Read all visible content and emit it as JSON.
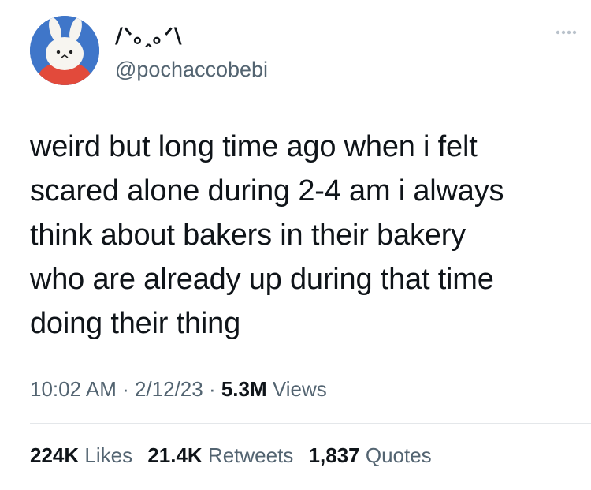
{
  "author": {
    "display_name": "/ᐠ｡ꞈ｡ᐟ\\",
    "handle": "@pochaccobebi",
    "avatar_icon": "white-bunny-avatar-icon"
  },
  "more_icon": "more-dots-icon",
  "tweet": {
    "text": "weird but long time ago when i felt\nscared alone during 2-4 am i always\nthink about bakers in their bakery\nwho are already up during that time\ndoing their thing"
  },
  "meta": {
    "time": "10:02 AM",
    "separator1": " · ",
    "date": "2/12/23",
    "separator2": " · ",
    "views_count": "5.3M",
    "views_label": " Views"
  },
  "stats": {
    "likes_count": "224K",
    "likes_label": " Likes",
    "retweets_count": "21.4K",
    "retweets_label": " Retweets",
    "quotes_count": "1,837",
    "quotes_label": " Quotes"
  },
  "colors": {
    "text_primary": "#0f1419",
    "text_secondary": "#536471",
    "avatar_background": "#3a6fc4"
  }
}
